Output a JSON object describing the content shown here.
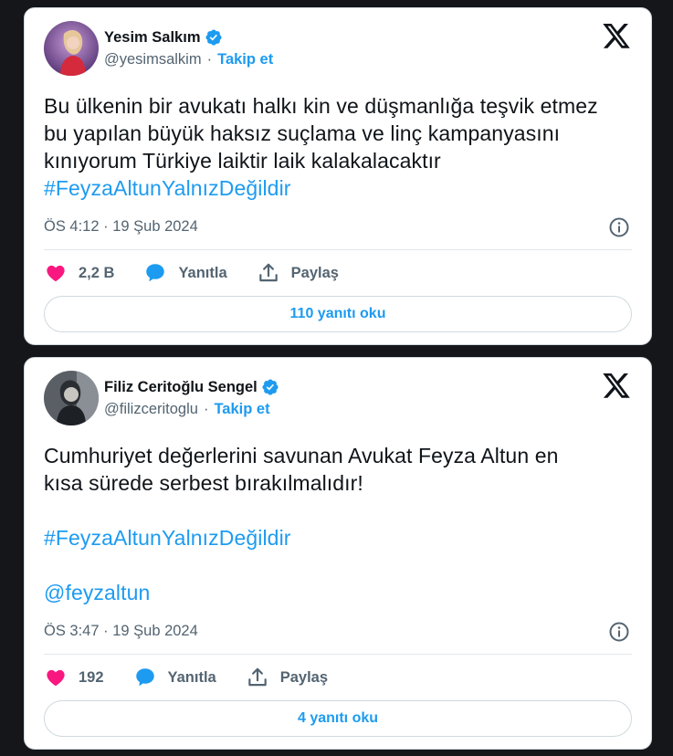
{
  "colors": {
    "link": "#1d9bf0",
    "like": "#f91880",
    "reply": "#1d9bf0",
    "page_bg": "#15161a"
  },
  "tweets": [
    {
      "author_name": "Yesim Salkım",
      "handle": "@yesimsalkim",
      "separator": "·",
      "follow_label": "Takip et",
      "lines": [
        "Bu ülkenin bir avukatı halkı kin ve düşmanlığa teşvik etmez",
        "bu yapılan büyük haksız suçlama ve linç kampanyasını",
        "kınıyorum Türkiye laiktir laik kalakalacaktır"
      ],
      "hashtag": "#FeyzaAltunYalnızDeğildir",
      "timestamp": "ÖS 4:12 · 19 Şub 2024",
      "like_count": "2,2 B",
      "reply_label": "Yanıtla",
      "share_label": "Paylaş",
      "read_replies_label": "110 yanıtı oku",
      "icons": [
        "verified-icon",
        "x-logo-icon",
        "info-icon",
        "heart-icon",
        "reply-bubble-icon",
        "share-icon"
      ]
    },
    {
      "author_name": "Filiz Ceritoğlu Sengel",
      "handle": "@filizceritoglu",
      "separator": "·",
      "follow_label": "Takip et",
      "lines": [
        "Cumhuriyet değerlerini savunan Avukat Feyza Altun en",
        "kısa sürede serbest bırakılmalıdır!"
      ],
      "hashtag": "#FeyzaAltunYalnızDeğildir",
      "mention": "@feyzaltun",
      "timestamp": "ÖS 3:47 · 19 Şub 2024",
      "like_count": "192",
      "reply_label": "Yanıtla",
      "share_label": "Paylaş",
      "read_replies_label": "4 yanıtı oku",
      "icons": [
        "verified-icon",
        "x-logo-icon",
        "info-icon",
        "heart-icon",
        "reply-bubble-icon",
        "share-icon"
      ]
    }
  ]
}
